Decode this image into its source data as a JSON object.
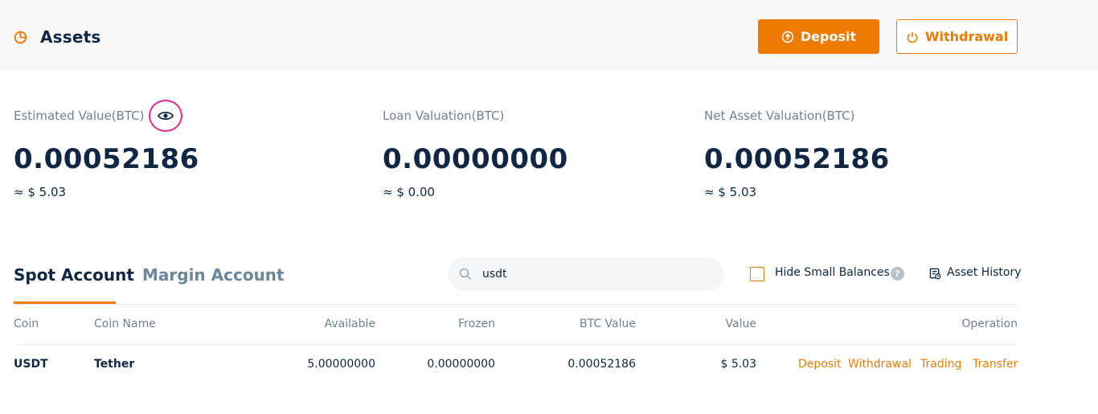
{
  "header": {
    "title": "Assets",
    "deposit_label": "Deposit",
    "withdrawal_label": "Withdrawal"
  },
  "summary": {
    "estimated": {
      "label": "Estimated Value(BTC)",
      "value": "0.00052186",
      "usd": "≈ $ 5.03"
    },
    "loan": {
      "label": "Loan Valuation(BTC)",
      "value": "0.00000000",
      "usd": "≈ $ 0.00"
    },
    "net": {
      "label": "Net Asset Valuation(BTC)",
      "value": "0.00052186",
      "usd": "≈ $ 5.03"
    }
  },
  "tabs": {
    "spot": "Spot Account",
    "margin": "Margin Account"
  },
  "search": {
    "value": "usdt"
  },
  "filters": {
    "hide_small_label": "Hide Small Balances",
    "help_glyph": "?",
    "asset_history_label": "Asset History"
  },
  "table": {
    "headers": {
      "coin": "Coin",
      "coin_name": "Coin Name",
      "available": "Available",
      "frozen": "Frozen",
      "btc_value": "BTC Value",
      "value": "Value",
      "operation": "Operation"
    },
    "rows": [
      {
        "coin": "USDT",
        "coin_name": "Tether",
        "available": "5.00000000",
        "frozen": "0.00000000",
        "btc_value": "0.00052186",
        "value": "$ 5.03",
        "ops": {
          "deposit": "Deposit",
          "withdrawal": "Withdrawal",
          "trading": "Trading",
          "transfer": "Transfer"
        }
      }
    ]
  },
  "colors": {
    "accent": "#ef7a02",
    "text": "#0f2745",
    "muted": "#6f8193",
    "highlight_ring": "#e8278f"
  },
  "icons": [
    "pie-chart-icon",
    "deposit-icon",
    "power-icon",
    "eye-icon",
    "search-icon",
    "help-icon",
    "asset-history-icon"
  ]
}
